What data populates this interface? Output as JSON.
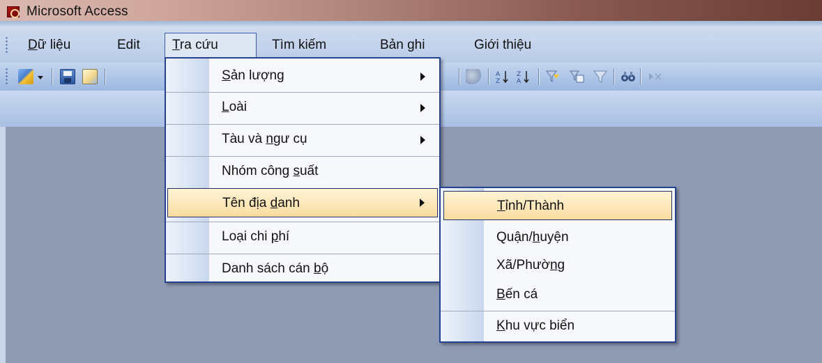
{
  "window": {
    "title": "Microsoft Access",
    "app_icon": "access-key-icon"
  },
  "menubar": {
    "items": [
      {
        "pre": "",
        "ul": "D",
        "post": "ữ liệu"
      },
      {
        "pre": "Edit",
        "ul": "",
        "post": ""
      },
      {
        "pre": "",
        "ul": "T",
        "post": "ra cứu"
      },
      {
        "pre": "Tìm kiếm",
        "ul": "",
        "post": ""
      },
      {
        "pre": "Bản ghi",
        "ul": "",
        "post": ""
      },
      {
        "pre": "Giới thiệu",
        "ul": "",
        "post": ""
      }
    ],
    "open_menu": "Tra cứu"
  },
  "toolbar": {
    "icons": [
      "design-view-icon",
      "dropdown-arrow-icon",
      "save-icon",
      "print-preview-icon",
      "relationships-icon",
      "sort-ascending-icon",
      "sort-descending-icon",
      "filter-by-selection-icon",
      "filter-by-form-icon",
      "apply-filter-icon",
      "find-icon",
      "new-record-icon"
    ]
  },
  "tra_cuu_menu": {
    "items": [
      {
        "pre": "",
        "ul": "S",
        "post": "ản lượng",
        "submenu": true
      },
      {
        "pre": "",
        "ul": "L",
        "post": "oài",
        "submenu": true
      },
      {
        "pre": "Tàu và ",
        "ul": "n",
        "post": "gư cụ",
        "submenu": true
      },
      {
        "pre": "Nhóm công ",
        "ul": "s",
        "post": "uất",
        "submenu": false
      },
      {
        "pre": "Tên địa ",
        "ul": "d",
        "post": "anh",
        "submenu": true,
        "highlighted": true
      },
      {
        "pre": "Loại chi ",
        "ul": "p",
        "post": "hí",
        "submenu": false
      },
      {
        "pre": "Danh sách cán ",
        "ul": "b",
        "post": "ộ",
        "submenu": false
      }
    ]
  },
  "dia_danh_submenu": {
    "items": [
      {
        "pre": "",
        "ul": "T",
        "post": "ỉnh/Thành",
        "highlighted": true
      },
      {
        "pre": "Quận/",
        "ul": "h",
        "post": "uyện"
      },
      {
        "pre": "Xã/Phườ",
        "ul": "n",
        "post": "g"
      },
      {
        "pre": "",
        "ul": "B",
        "post": "ến cá"
      },
      {
        "pre": "",
        "ul": "K",
        "post": "hu vực biển"
      }
    ]
  },
  "colors": {
    "menu_border": "#24428f",
    "highlight_top": "#fff4d6",
    "highlight_bottom": "#fbdca0",
    "workspace": "#8f9bb3",
    "bar_light": "#cfdcf0",
    "bar_dark": "#9cb7e0"
  }
}
